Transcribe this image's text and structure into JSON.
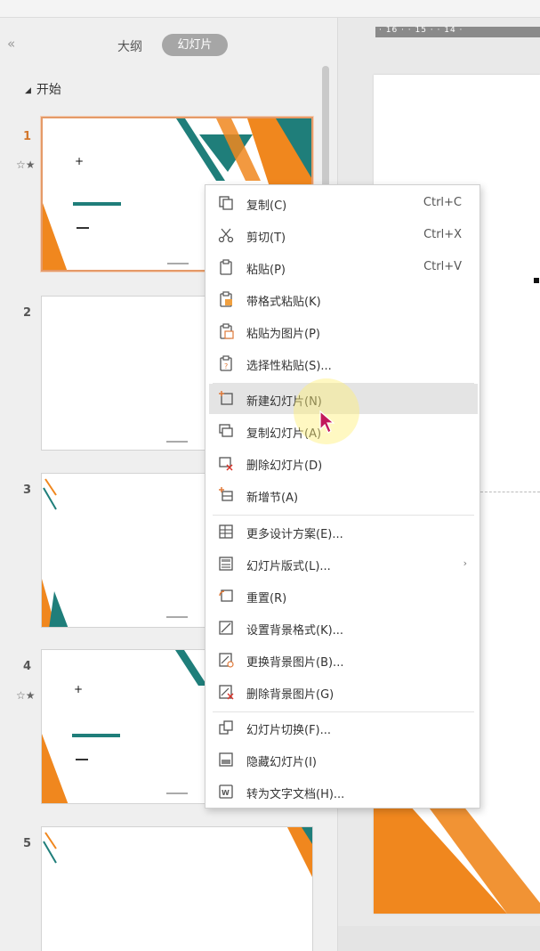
{
  "panel": {
    "collapse_glyph": "«",
    "tab_outline": "大纲",
    "tab_slides": "幻灯片",
    "section_label": "开始"
  },
  "slides": [
    {
      "number": "1",
      "star": "☆★"
    },
    {
      "number": "2"
    },
    {
      "number": "3"
    },
    {
      "number": "4",
      "star": "☆★"
    },
    {
      "number": "5"
    }
  ],
  "ruler": {
    "ticks": "· 16 · · 15 · · 14 ·"
  },
  "menu": {
    "items": [
      {
        "label": "复制(C)",
        "shortcut": "Ctrl+C",
        "icon": "copy-icon"
      },
      {
        "label": "剪切(T)",
        "shortcut": "Ctrl+X",
        "icon": "cut-icon"
      },
      {
        "label": "粘贴(P)",
        "shortcut": "Ctrl+V",
        "icon": "paste-icon"
      },
      {
        "label": "带格式粘贴(K)",
        "icon": "paste-format-icon"
      },
      {
        "label": "粘贴为图片(P)",
        "icon": "paste-picture-icon"
      },
      {
        "label": "选择性粘贴(S)...",
        "icon": "paste-special-icon"
      },
      {
        "label": "新建幻灯片(N)",
        "icon": "new-slide-icon"
      },
      {
        "label": "复制幻灯片(A)",
        "icon": "duplicate-slide-icon"
      },
      {
        "label": "删除幻灯片(D)",
        "icon": "delete-slide-icon"
      },
      {
        "label": "新增节(A)",
        "icon": "new-section-icon"
      },
      {
        "label": "更多设计方案(E)...",
        "icon": "design-icon"
      },
      {
        "label": "幻灯片版式(L)...",
        "icon": "layout-icon",
        "submenu": "›"
      },
      {
        "label": "重置(R)",
        "icon": "reset-icon"
      },
      {
        "label": "设置背景格式(K)...",
        "icon": "background-format-icon"
      },
      {
        "label": "更换背景图片(B)...",
        "icon": "change-background-icon"
      },
      {
        "label": "删除背景图片(G)",
        "icon": "delete-background-icon"
      },
      {
        "label": "幻灯片切换(F)...",
        "icon": "transition-icon"
      },
      {
        "label": "隐藏幻灯片(I)",
        "icon": "hide-slide-icon"
      },
      {
        "label": "转为文字文档(H)...",
        "icon": "convert-doc-icon"
      }
    ],
    "highlighted_label": "新建幻灯片(N)"
  },
  "colors": {
    "orange": "#f0871e",
    "teal": "#1f7e7a",
    "selection_border": "#e59a68",
    "menu_highlight": "#e4e4e4"
  }
}
